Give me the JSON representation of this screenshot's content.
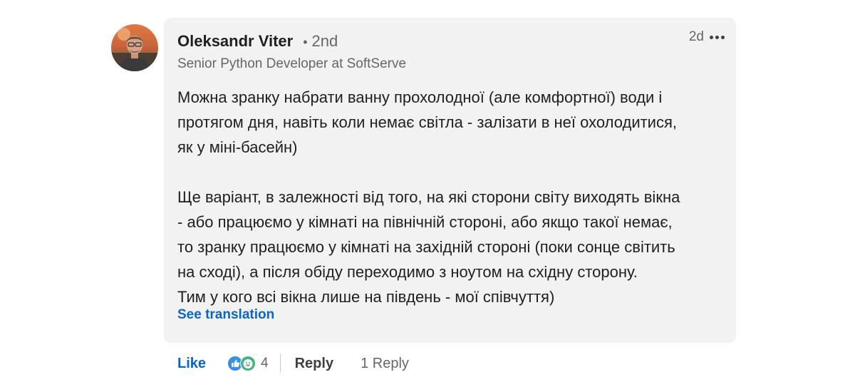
{
  "comment": {
    "author": {
      "name": "Oleksandr Viter",
      "connection_degree": "2nd",
      "headline": "Senior Python Developer at SoftServe"
    },
    "time_ago": "2d",
    "more_icon": "more-horizontal-icon",
    "body": {
      "paragraph_1": "Можна зранку набрати ванну прохолодної (але комфортної) води і\nпротягом дня, навіть коли немає світла - залізати в неї охолодитися,\nяк у міні-басейн)",
      "paragraph_2": "Ще варіант, в залежності від того, на які сторони світу виходять вікна\n- або працюємо у кімнаті на північній стороні, або якщо такої немає,\nто зранку працюємо у кімнаті на західній стороні (поки сонце світить\nна сході), а після обіду переходимо з ноутом на східну сторону.\nТим у кого всі вікна лише на південь - мої співчуття)"
    },
    "see_translation_label": "See translation"
  },
  "actions": {
    "like_label": "Like",
    "reaction_icons": [
      "like-reaction-icon",
      "funny-reaction-icon"
    ],
    "reaction_count": "4",
    "reply_label": "Reply",
    "replies_label": "1 Reply"
  },
  "colors": {
    "accent": "#0a66c2",
    "bubble_background": "#f2f2f2",
    "secondary_text": "#666666"
  }
}
